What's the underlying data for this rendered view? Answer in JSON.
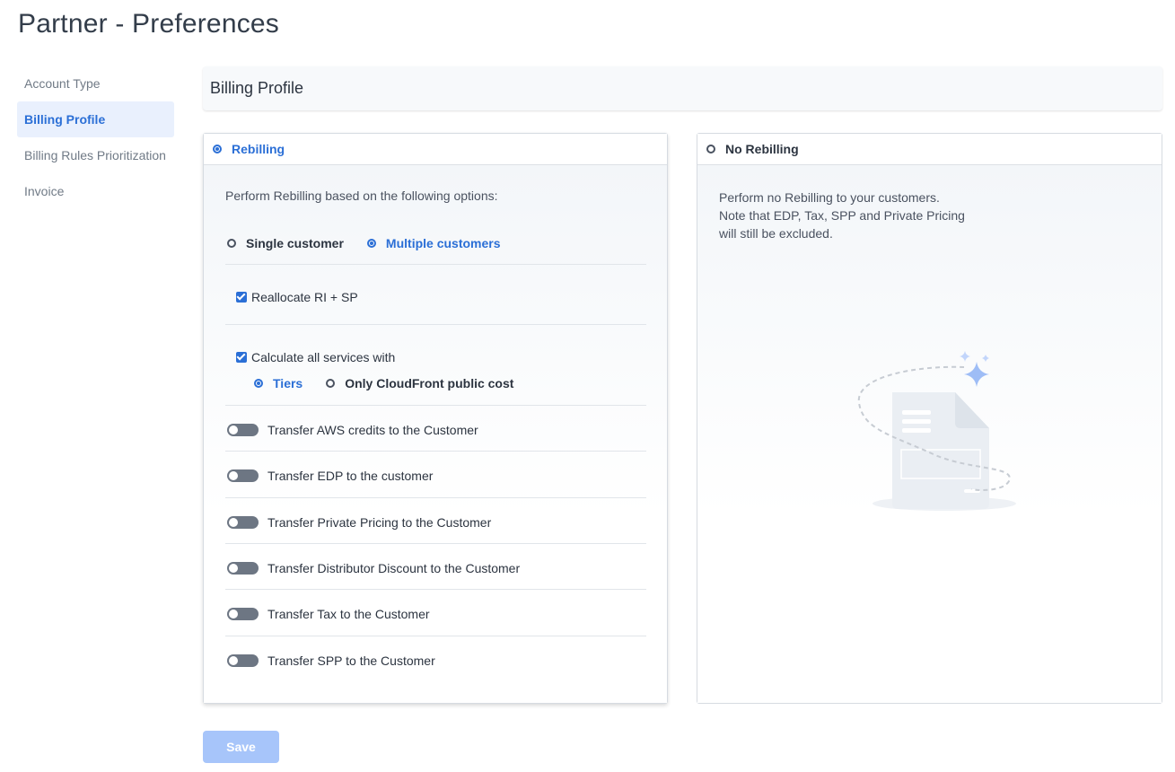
{
  "page": {
    "title": "Partner - Preferences"
  },
  "sidebar": {
    "items": [
      {
        "label": "Account Type"
      },
      {
        "label": "Billing Profile",
        "active": true
      },
      {
        "label": "Billing Rules Prioritization"
      },
      {
        "label": "Invoice"
      }
    ]
  },
  "section": {
    "title": "Billing Profile"
  },
  "rebilling": {
    "label": "Rebilling",
    "selected": true,
    "intro": "Perform Rebilling based on the following options:",
    "customer_options": [
      {
        "label": "Single customer",
        "selected": false
      },
      {
        "label": "Multiple customers",
        "selected": true
      }
    ],
    "reallocate": {
      "label": "Reallocate RI + SP",
      "checked": true
    },
    "calculate": {
      "label": "Calculate all services with",
      "checked": true
    },
    "calc_options": [
      {
        "label": "Tiers",
        "selected": true
      },
      {
        "label": "Only CloudFront public cost",
        "selected": false
      }
    ],
    "toggles": [
      {
        "label": "Transfer AWS credits to the Customer",
        "on": false
      },
      {
        "label": "Transfer EDP to the customer",
        "on": false
      },
      {
        "label": "Transfer Private Pricing to the Customer",
        "on": false
      },
      {
        "label": "Transfer Distributor Discount to the Customer",
        "on": false
      },
      {
        "label": "Transfer Tax to the Customer",
        "on": false
      },
      {
        "label": "Transfer SPP to the Customer",
        "on": false
      }
    ]
  },
  "no_rebilling": {
    "label": "No Rebilling",
    "selected": false,
    "lines": [
      "Perform no Rebilling to your customers.",
      "Note that EDP, Tax, SPP and Private Pricing",
      "will still be excluded."
    ],
    "illustration_icon": "document-sparkle-icon"
  },
  "footer": {
    "save_label": "Save",
    "save_disabled": true
  },
  "colors": {
    "accent": "#2b6fd6",
    "active_nav_bg": "#e9f0fd",
    "save_disabled": "#a7c5fa",
    "toggle_off": "#6d7683"
  }
}
